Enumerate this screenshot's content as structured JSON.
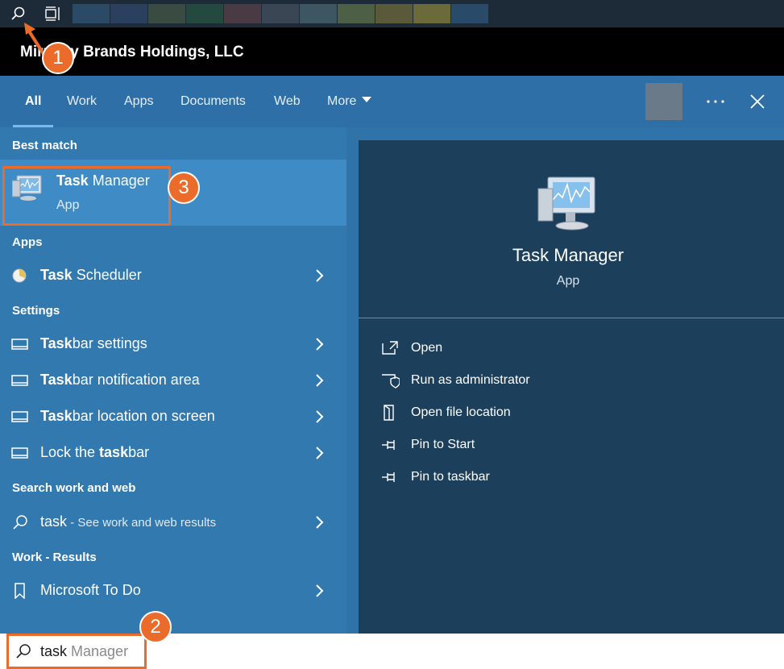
{
  "taskbar": {
    "thumb_colors": [
      "#2b4a66",
      "#2b3f5e",
      "#3a4b42",
      "#244a40",
      "#4a3a44",
      "#3a4654",
      "#3e5562",
      "#4d6046",
      "#5a5a3a",
      "#6a6a3a",
      "#2a4a6a"
    ]
  },
  "header": {
    "org_name": "Mirrorry Brands Holdings, LLC"
  },
  "tabs": [
    {
      "label": "All"
    },
    {
      "label": "Work"
    },
    {
      "label": "Apps"
    },
    {
      "label": "Documents"
    },
    {
      "label": "Web"
    },
    {
      "label": "More"
    }
  ],
  "left": {
    "best_match_heading": "Best match",
    "best_match": {
      "title_bold": "Task",
      "title_rest": " Manager",
      "subtitle": "App"
    },
    "apps_heading": "Apps",
    "apps": [
      {
        "bold": "Task",
        "rest": " Scheduler"
      }
    ],
    "settings_heading": "Settings",
    "settings": [
      {
        "pre": "",
        "bold": "Task",
        "rest": "bar settings"
      },
      {
        "pre": "",
        "bold": "Task",
        "rest": "bar notification area"
      },
      {
        "pre": "",
        "bold": "Task",
        "rest": "bar location on screen"
      },
      {
        "pre": "Lock the ",
        "bold": "task",
        "rest": "bar"
      }
    ],
    "web_heading": "Search work and web",
    "web": {
      "query": "task",
      "hint": " - See work and web results"
    },
    "work_heading": "Work - Results",
    "work": [
      {
        "label": "Microsoft To Do"
      }
    ]
  },
  "preview": {
    "title": "Task Manager",
    "subtitle": "App",
    "actions": [
      {
        "label": "Open"
      },
      {
        "label": "Run as administrator"
      },
      {
        "label": "Open file location"
      },
      {
        "label": "Pin to Start"
      },
      {
        "label": "Pin to taskbar"
      }
    ]
  },
  "search": {
    "typed": "task",
    "suggestion": " Manager"
  },
  "badges": {
    "one": "1",
    "two": "2",
    "three": "3"
  },
  "colors": {
    "accent": "#ea6b2a",
    "panel": "#3279b0",
    "preview": "#1c3f5c"
  }
}
